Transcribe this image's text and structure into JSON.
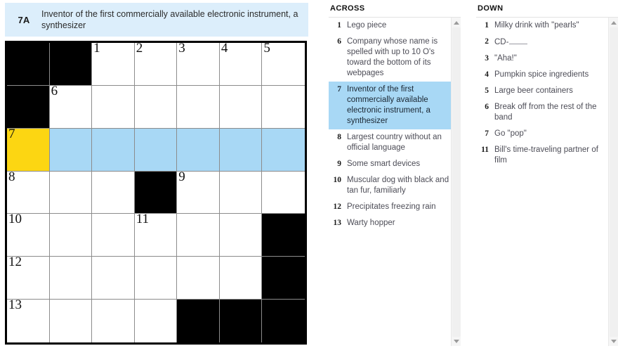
{
  "current_clue": {
    "label": "7A",
    "text": "Inventor of the first commercially available electronic instrument, a synthesizer"
  },
  "colors": {
    "highlight": "#a8d8f5",
    "cursor": "#fcd612",
    "banner_bg": "#dceefb",
    "block": "#000000"
  },
  "grid": {
    "rows": 7,
    "cols": 7,
    "cells": [
      [
        {
          "type": "block"
        },
        {
          "type": "block"
        },
        {
          "type": "open",
          "num": "1"
        },
        {
          "type": "open",
          "num": "2"
        },
        {
          "type": "open",
          "num": "3"
        },
        {
          "type": "open",
          "num": "4"
        },
        {
          "type": "open",
          "num": "5"
        }
      ],
      [
        {
          "type": "block"
        },
        {
          "type": "open",
          "num": "6"
        },
        {
          "type": "open"
        },
        {
          "type": "open"
        },
        {
          "type": "open"
        },
        {
          "type": "open"
        },
        {
          "type": "open"
        }
      ],
      [
        {
          "type": "open",
          "num": "7",
          "state": "cursor"
        },
        {
          "type": "open",
          "state": "highlight"
        },
        {
          "type": "open",
          "state": "highlight"
        },
        {
          "type": "open",
          "state": "highlight"
        },
        {
          "type": "open",
          "state": "highlight"
        },
        {
          "type": "open",
          "state": "highlight"
        },
        {
          "type": "open",
          "state": "highlight"
        }
      ],
      [
        {
          "type": "open",
          "num": "8"
        },
        {
          "type": "open"
        },
        {
          "type": "open"
        },
        {
          "type": "block"
        },
        {
          "type": "open",
          "num": "9"
        },
        {
          "type": "open"
        },
        {
          "type": "open"
        }
      ],
      [
        {
          "type": "open",
          "num": "10"
        },
        {
          "type": "open"
        },
        {
          "type": "open"
        },
        {
          "type": "open",
          "num": "11"
        },
        {
          "type": "open"
        },
        {
          "type": "open"
        },
        {
          "type": "block"
        }
      ],
      [
        {
          "type": "open",
          "num": "12"
        },
        {
          "type": "open"
        },
        {
          "type": "open"
        },
        {
          "type": "open"
        },
        {
          "type": "open"
        },
        {
          "type": "open"
        },
        {
          "type": "block"
        }
      ],
      [
        {
          "type": "open",
          "num": "13"
        },
        {
          "type": "open"
        },
        {
          "type": "open"
        },
        {
          "type": "open"
        },
        {
          "type": "block"
        },
        {
          "type": "block"
        },
        {
          "type": "block"
        }
      ]
    ]
  },
  "across": {
    "title": "ACROSS",
    "clues": [
      {
        "num": "1",
        "text": "Lego piece",
        "state": "normal"
      },
      {
        "num": "6",
        "text": "Company whose name is spelled with up to 10 O's toward the bottom of its webpages",
        "state": "normal"
      },
      {
        "num": "7",
        "text": "Inventor of the first commercially available electronic instrument, a synthesizer",
        "state": "selected"
      },
      {
        "num": "8",
        "text": "Largest country without an official language",
        "state": "normal"
      },
      {
        "num": "9",
        "text": "Some smart devices",
        "state": "normal"
      },
      {
        "num": "10",
        "text": "Muscular dog with black and tan fur, familiarly",
        "state": "normal"
      },
      {
        "num": "12",
        "text": "Precipitates freezing rain",
        "state": "normal"
      },
      {
        "num": "13",
        "text": "Warty hopper",
        "state": "normal"
      }
    ]
  },
  "down": {
    "title": "DOWN",
    "clues": [
      {
        "num": "1",
        "text": "Milky drink with \"pearls\"",
        "state": "normal"
      },
      {
        "num": "2",
        "text": "CD-",
        "blank": true,
        "state": "normal"
      },
      {
        "num": "3",
        "text": "\"Aha!\"",
        "state": "normal"
      },
      {
        "num": "4",
        "text": "Pumpkin spice ingredients",
        "state": "normal"
      },
      {
        "num": "5",
        "text": "Large beer containers",
        "state": "normal"
      },
      {
        "num": "6",
        "text": "Break off from the rest of the band",
        "state": "normal"
      },
      {
        "num": "7",
        "text": "Go \"pop\"",
        "state": "crossref"
      },
      {
        "num": "11",
        "text": "Bill's time-traveling partner of film",
        "state": "normal"
      }
    ]
  },
  "scrollbars": {
    "across": {
      "up_arrow": "scroll-up",
      "down_arrow": "scroll-down"
    },
    "down": {
      "up_arrow": "scroll-up",
      "down_arrow": "scroll-down"
    }
  }
}
